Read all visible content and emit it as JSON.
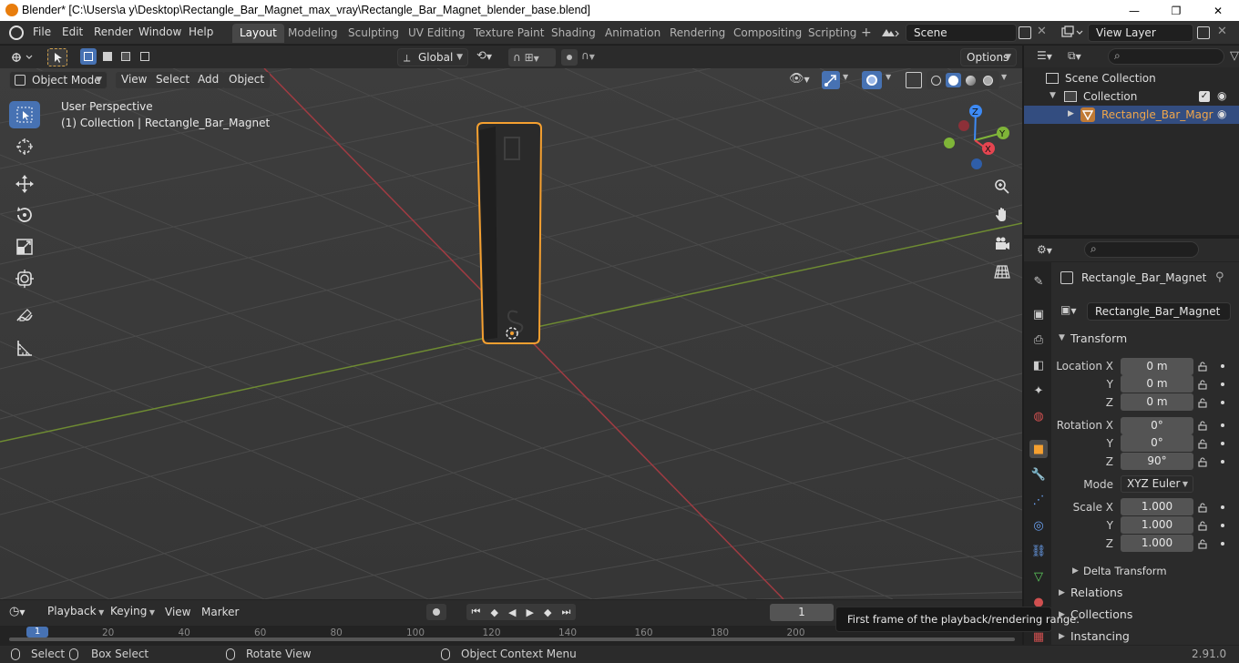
{
  "window": {
    "title": "Blender* [C:\\Users\\a y\\Desktop\\Rectangle_Bar_Magnet_max_vray\\Rectangle_Bar_Magnet_blender_base.blend]",
    "minimize": "—",
    "maximize": "❐",
    "close": "✕"
  },
  "menu": [
    "File",
    "Edit",
    "Render",
    "Window",
    "Help"
  ],
  "workspaces": [
    "Layout",
    "Modeling",
    "Sculpting",
    "UV Editing",
    "Texture Paint",
    "Shading",
    "Animation",
    "Rendering",
    "Compositing",
    "Scripting"
  ],
  "active_workspace": "Layout",
  "scene": {
    "name": "Scene"
  },
  "view_layer": {
    "name": "View Layer"
  },
  "toolbar": {
    "transform_orientation": "Global",
    "options": "Options"
  },
  "viewport_header": {
    "mode": "Object Mode",
    "view": "View",
    "select": "Select",
    "add": "Add",
    "object": "Object"
  },
  "viewport": {
    "perspective": "User Perspective",
    "collection_info": "(1) Collection | Rectangle_Bar_Magnet",
    "gizmo": {
      "x": "X",
      "y": "Y",
      "z": "Z"
    }
  },
  "outliner": {
    "scene_collection": "Scene Collection",
    "collection": "Collection",
    "object": "Rectangle_Bar_Magr"
  },
  "properties": {
    "object_name": "Rectangle_Bar_Magnet",
    "datablock_name": "Rectangle_Bar_Magnet",
    "transform_label": "Transform",
    "location_label": "Location X",
    "rotation_label": "Rotation X",
    "scale_label": "Scale X",
    "axis_y": "Y",
    "axis_z": "Z",
    "location": [
      "0 m",
      "0 m",
      "0 m"
    ],
    "rotation": [
      "0°",
      "0°",
      "90°"
    ],
    "mode_label": "Mode",
    "mode_value": "XYZ Euler",
    "scale": [
      "1.000",
      "1.000",
      "1.000"
    ],
    "delta_transform": "Delta Transform",
    "relations": "Relations",
    "collections": "Collections",
    "instancing": "Instancing"
  },
  "timeline": {
    "playback": "Playback",
    "keying": "Keying",
    "view": "View",
    "marker": "Marker",
    "current_frame": "1",
    "ruler_ticks": [
      "1",
      "20",
      "40",
      "60",
      "80",
      "100",
      "120",
      "140",
      "160",
      "180",
      "200"
    ],
    "tooltip": "First frame of the playback/rendering range."
  },
  "statusbar": {
    "select": "Select",
    "box_select": "Box Select",
    "rotate_view": "Rotate View",
    "context_menu": "Object Context Menu",
    "version": "2.91.0"
  },
  "colors": {
    "accent_blue": "#4772b3",
    "selection_orange": "#f5a030",
    "x_axis": "#e64550",
    "y_axis": "#7fb538",
    "z_axis": "#3d8af5"
  }
}
